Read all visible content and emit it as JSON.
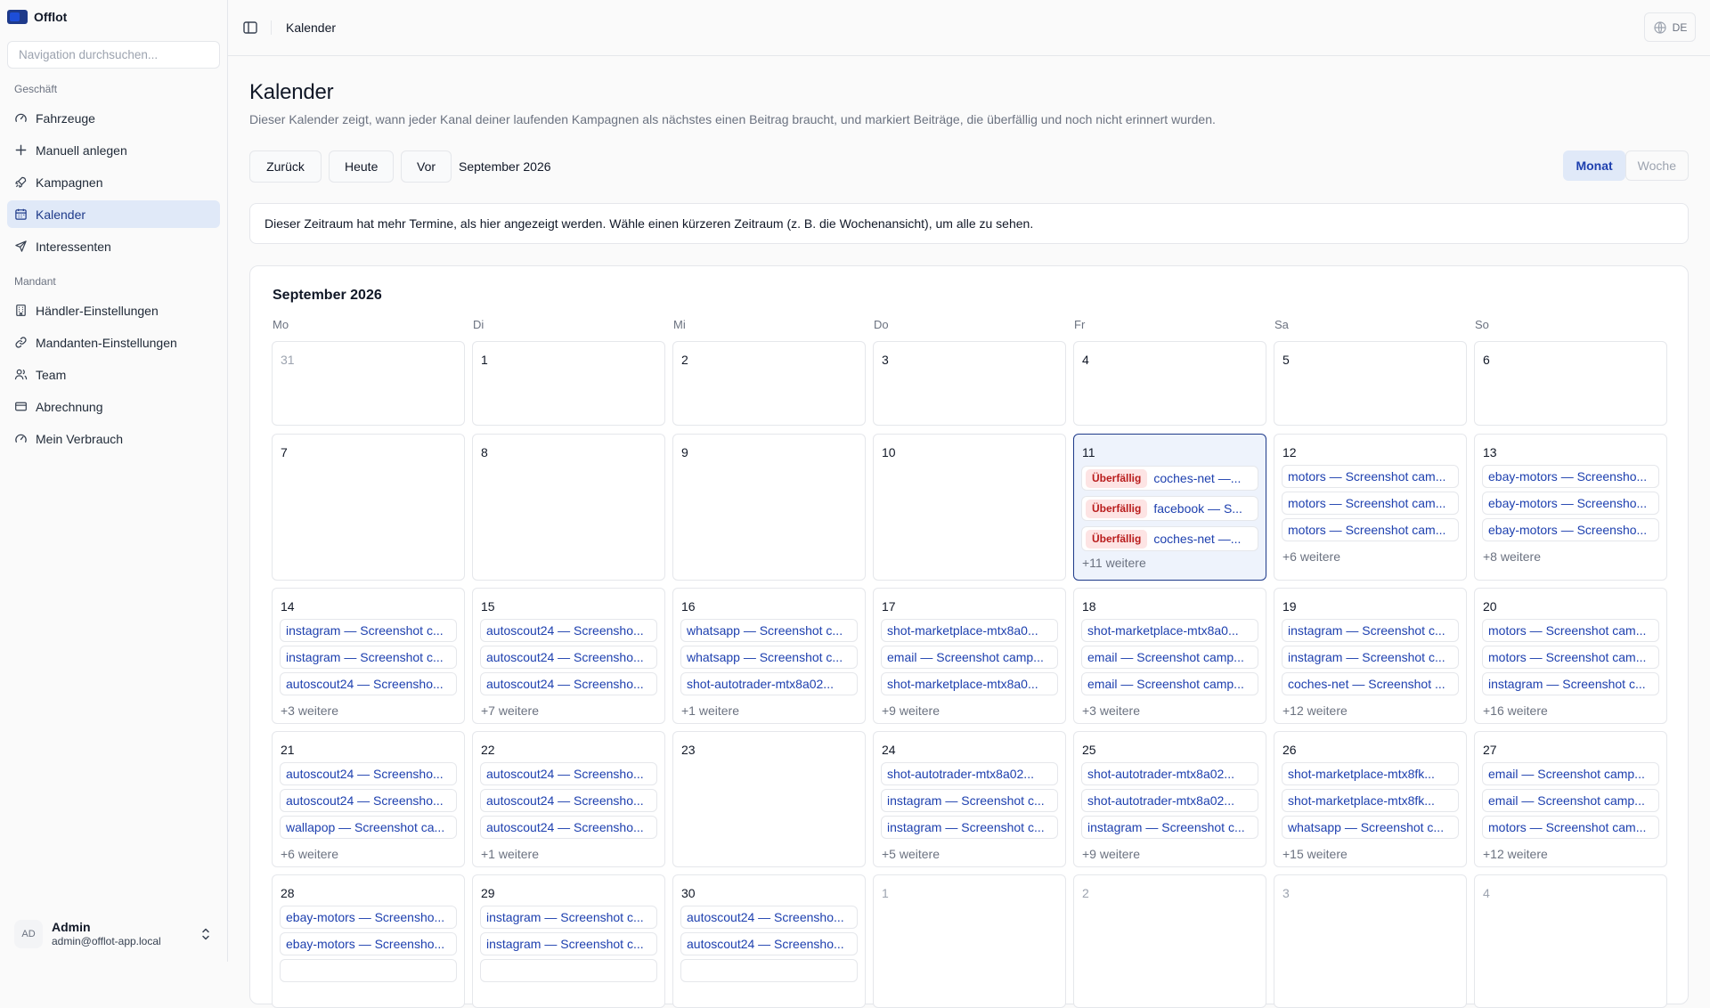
{
  "app": {
    "name": "Offlot"
  },
  "sidebar": {
    "search_placeholder": "Navigation durchsuchen...",
    "groups": [
      {
        "label": "Geschäft",
        "items": [
          {
            "label": "Fahrzeuge",
            "icon": "gauge-icon"
          },
          {
            "label": "Manuell anlegen",
            "icon": "plus-icon"
          },
          {
            "label": "Kampagnen",
            "icon": "rocket-icon"
          },
          {
            "label": "Kalender",
            "icon": "calendar-icon",
            "active": true
          },
          {
            "label": "Interessenten",
            "icon": "send-icon"
          }
        ]
      },
      {
        "label": "Mandant",
        "items": [
          {
            "label": "Händler-Einstellungen",
            "icon": "building-icon"
          },
          {
            "label": "Mandanten-Einstellungen",
            "icon": "link-icon"
          },
          {
            "label": "Team",
            "icon": "users-icon"
          },
          {
            "label": "Abrechnung",
            "icon": "credit-card-icon"
          },
          {
            "label": "Mein Verbrauch",
            "icon": "gauge-icon"
          }
        ]
      }
    ],
    "user": {
      "initials": "AD",
      "name": "Admin",
      "email": "admin@offlot-app.local"
    }
  },
  "topbar": {
    "title": "Kalender",
    "language": "DE"
  },
  "page": {
    "title": "Kalender",
    "description": "Dieser Kalender zeigt, wann jeder Kanal deiner laufenden Kampagnen als nächstes einen Beitrag braucht, und markiert Beiträge, die überfällig und noch nicht erinnert wurden.",
    "buttons": {
      "prev": "Zurück",
      "today": "Heute",
      "next": "Vor"
    },
    "period_label": "September 2026",
    "views": {
      "month": "Monat",
      "week": "Woche",
      "active": "Monat"
    },
    "notice": "Dieser Zeitraum hat mehr Termine, als hier angezeigt werden. Wähle einen kürzeren Zeitraum (z. B. die Wochenansicht), um alle zu sehen."
  },
  "calendar": {
    "title": "September 2026",
    "weekdays": [
      "Mo",
      "Di",
      "Mi",
      "Do",
      "Fr",
      "Sa",
      "So"
    ],
    "overdue_label": "Überfällig",
    "weeks": [
      [
        {
          "day": "31",
          "outside": true,
          "events": []
        },
        {
          "day": "1",
          "events": []
        },
        {
          "day": "2",
          "events": []
        },
        {
          "day": "3",
          "events": []
        },
        {
          "day": "4",
          "events": []
        },
        {
          "day": "5",
          "events": []
        },
        {
          "day": "6",
          "events": []
        }
      ],
      [
        {
          "day": "7",
          "events": []
        },
        {
          "day": "8",
          "events": []
        },
        {
          "day": "9",
          "events": []
        },
        {
          "day": "10",
          "events": []
        },
        {
          "day": "11",
          "today": true,
          "events": [
            {
              "text": "coches-net —...",
              "overdue": true
            },
            {
              "text": "facebook — S...",
              "overdue": true
            },
            {
              "text": "coches-net —...",
              "overdue": true
            }
          ],
          "more": "+11 weitere"
        },
        {
          "day": "12",
          "events": [
            {
              "text": "motors — Screenshot cam..."
            },
            {
              "text": "motors — Screenshot cam..."
            },
            {
              "text": "motors — Screenshot cam..."
            }
          ],
          "more": "+6 weitere"
        },
        {
          "day": "13",
          "events": [
            {
              "text": "ebay-motors — Screensho..."
            },
            {
              "text": "ebay-motors — Screensho..."
            },
            {
              "text": "ebay-motors — Screensho..."
            }
          ],
          "more": "+8 weitere"
        }
      ],
      [
        {
          "day": "14",
          "events": [
            {
              "text": "instagram — Screenshot c..."
            },
            {
              "text": "instagram — Screenshot c..."
            },
            {
              "text": "autoscout24 — Screensho..."
            }
          ],
          "more": "+3 weitere"
        },
        {
          "day": "15",
          "events": [
            {
              "text": "autoscout24 — Screensho..."
            },
            {
              "text": "autoscout24 — Screensho..."
            },
            {
              "text": "autoscout24 — Screensho..."
            }
          ],
          "more": "+7 weitere"
        },
        {
          "day": "16",
          "events": [
            {
              "text": "whatsapp — Screenshot c..."
            },
            {
              "text": "whatsapp — Screenshot c..."
            },
            {
              "text": "shot-autotrader-mtx8a02..."
            }
          ],
          "more": "+1 weitere"
        },
        {
          "day": "17",
          "events": [
            {
              "text": "shot-marketplace-mtx8a0..."
            },
            {
              "text": "email — Screenshot camp..."
            },
            {
              "text": "shot-marketplace-mtx8a0..."
            }
          ],
          "more": "+9 weitere"
        },
        {
          "day": "18",
          "events": [
            {
              "text": "shot-marketplace-mtx8a0..."
            },
            {
              "text": "email — Screenshot camp..."
            },
            {
              "text": "email — Screenshot camp..."
            }
          ],
          "more": "+3 weitere"
        },
        {
          "day": "19",
          "events": [
            {
              "text": "instagram — Screenshot c..."
            },
            {
              "text": "instagram — Screenshot c..."
            },
            {
              "text": "coches-net — Screenshot ..."
            }
          ],
          "more": "+12 weitere"
        },
        {
          "day": "20",
          "events": [
            {
              "text": "motors — Screenshot cam..."
            },
            {
              "text": "motors — Screenshot cam..."
            },
            {
              "text": "instagram — Screenshot c..."
            }
          ],
          "more": "+16 weitere"
        }
      ],
      [
        {
          "day": "21",
          "events": [
            {
              "text": "autoscout24 — Screensho..."
            },
            {
              "text": "autoscout24 — Screensho..."
            },
            {
              "text": "wallapop — Screenshot ca..."
            }
          ],
          "more": "+6 weitere"
        },
        {
          "day": "22",
          "events": [
            {
              "text": "autoscout24 — Screensho..."
            },
            {
              "text": "autoscout24 — Screensho..."
            },
            {
              "text": "autoscout24 — Screensho..."
            }
          ],
          "more": "+1 weitere"
        },
        {
          "day": "23",
          "events": []
        },
        {
          "day": "24",
          "events": [
            {
              "text": "shot-autotrader-mtx8a02..."
            },
            {
              "text": "instagram — Screenshot c..."
            },
            {
              "text": "instagram — Screenshot c..."
            }
          ],
          "more": "+5 weitere"
        },
        {
          "day": "25",
          "events": [
            {
              "text": "shot-autotrader-mtx8a02..."
            },
            {
              "text": "shot-autotrader-mtx8a02..."
            },
            {
              "text": "instagram — Screenshot c..."
            }
          ],
          "more": "+9 weitere"
        },
        {
          "day": "26",
          "events": [
            {
              "text": "shot-marketplace-mtx8fk..."
            },
            {
              "text": "shot-marketplace-mtx8fk..."
            },
            {
              "text": "whatsapp — Screenshot c..."
            }
          ],
          "more": "+15 weitere"
        },
        {
          "day": "27",
          "events": [
            {
              "text": "email — Screenshot camp..."
            },
            {
              "text": "email — Screenshot camp..."
            },
            {
              "text": "motors — Screenshot cam..."
            }
          ],
          "more": "+12 weitere"
        }
      ],
      [
        {
          "day": "28",
          "events": [
            {
              "text": "ebay-motors — Screensho..."
            },
            {
              "text": "ebay-motors — Screensho..."
            },
            {
              "text": ""
            }
          ]
        },
        {
          "day": "29",
          "events": [
            {
              "text": "instagram — Screenshot c..."
            },
            {
              "text": "instagram — Screenshot c..."
            },
            {
              "text": ""
            }
          ]
        },
        {
          "day": "30",
          "events": [
            {
              "text": "autoscout24 — Screensho..."
            },
            {
              "text": "autoscout24 — Screensho..."
            },
            {
              "text": ""
            }
          ]
        },
        {
          "day": "1",
          "outside": true,
          "events": []
        },
        {
          "day": "2",
          "outside": true,
          "events": []
        },
        {
          "day": "3",
          "outside": true,
          "events": []
        },
        {
          "day": "4",
          "outside": true,
          "events": []
        }
      ]
    ]
  },
  "colors": {
    "accent": "#1e40af",
    "active_bg": "#e0e9f8",
    "overdue_bg": "#fde4e4",
    "overdue_text": "#b91c1c"
  }
}
